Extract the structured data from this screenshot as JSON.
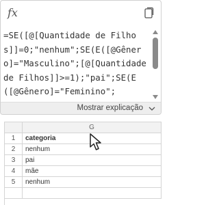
{
  "formula_editor": {
    "fx_symbol": "fx",
    "formula": "=SE([@[Quantidade de Filhos]]=0;\"nenhum\";SE(E([@Gênero]=\"Masculino\";[@[Quantidade de Filhos]]>=1);\"pai\";SE(E([@Gênero]=\"Feminino\";",
    "explain_label": "Mostrar explicação"
  },
  "sheet": {
    "column_header": "G",
    "rows": [
      {
        "num": "1",
        "value": "categoria"
      },
      {
        "num": "2",
        "value": "nenhum"
      },
      {
        "num": "3",
        "value": "pai"
      },
      {
        "num": "4",
        "value": "mãe"
      },
      {
        "num": "5",
        "value": "nenhum"
      }
    ]
  }
}
